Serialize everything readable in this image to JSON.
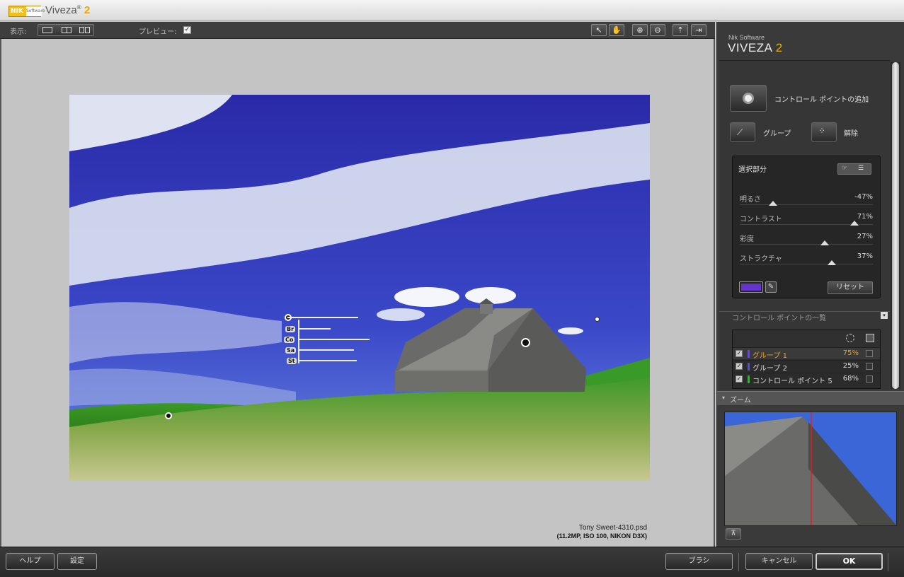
{
  "app": {
    "title_main": "Viveza",
    "title_reg": "®",
    "title_ver": "2",
    "logo_text": "NIK",
    "logo_sub": "Software"
  },
  "toolbar": {
    "view_label": "表示:",
    "preview_label": "プレビュー:",
    "preview_checked": "✓",
    "icons": [
      "pointer-icon",
      "hand-icon",
      "zoom-in-icon",
      "zoom-out-icon",
      "upload-icon",
      "export-icon"
    ]
  },
  "image": {
    "file_name": "Tony Sweet-4310.psd",
    "file_meta": "(11.2MP, ISO 100, NIKON D3X)",
    "overlay_labels": [
      "Br",
      "Co",
      "Sa",
      "St"
    ]
  },
  "panel": {
    "brand_sub": "Nik Software",
    "brand": "VIVEZA",
    "brand_ver": "2",
    "add_cp_label": "コントロール ポイントの追加",
    "group_label": "グループ",
    "ungroup_label": "解除",
    "selection_title": "選択部分",
    "sliders": [
      {
        "label": "明るさ",
        "value": "-47%",
        "pos": 0.25
      },
      {
        "label": "コントラスト",
        "value": "71%",
        "pos": 0.86
      },
      {
        "label": "彩度",
        "value": "27%",
        "pos": 0.64
      },
      {
        "label": "ストラクチャ",
        "value": "37%",
        "pos": 0.69
      }
    ],
    "color_swatch": "#6633cc",
    "reset_label": "リセット",
    "cp_list_title": "コントロール ポイントの一覧",
    "cp_list": [
      {
        "name": "グループ 1",
        "value": "75%",
        "color": "#6a4acc",
        "highlight": true
      },
      {
        "name": "グループ 2",
        "value": "25%",
        "color": "#5555aa",
        "highlight": false
      },
      {
        "name": "コントロール ポイント 5",
        "value": "68%",
        "color": "#3aaa3a",
        "highlight": false
      }
    ],
    "zoom_label": "ズーム"
  },
  "bottom": {
    "help": "ヘルプ",
    "settings": "設定",
    "brush": "ブラシ",
    "cancel": "キャンセル",
    "ok": "OK"
  }
}
